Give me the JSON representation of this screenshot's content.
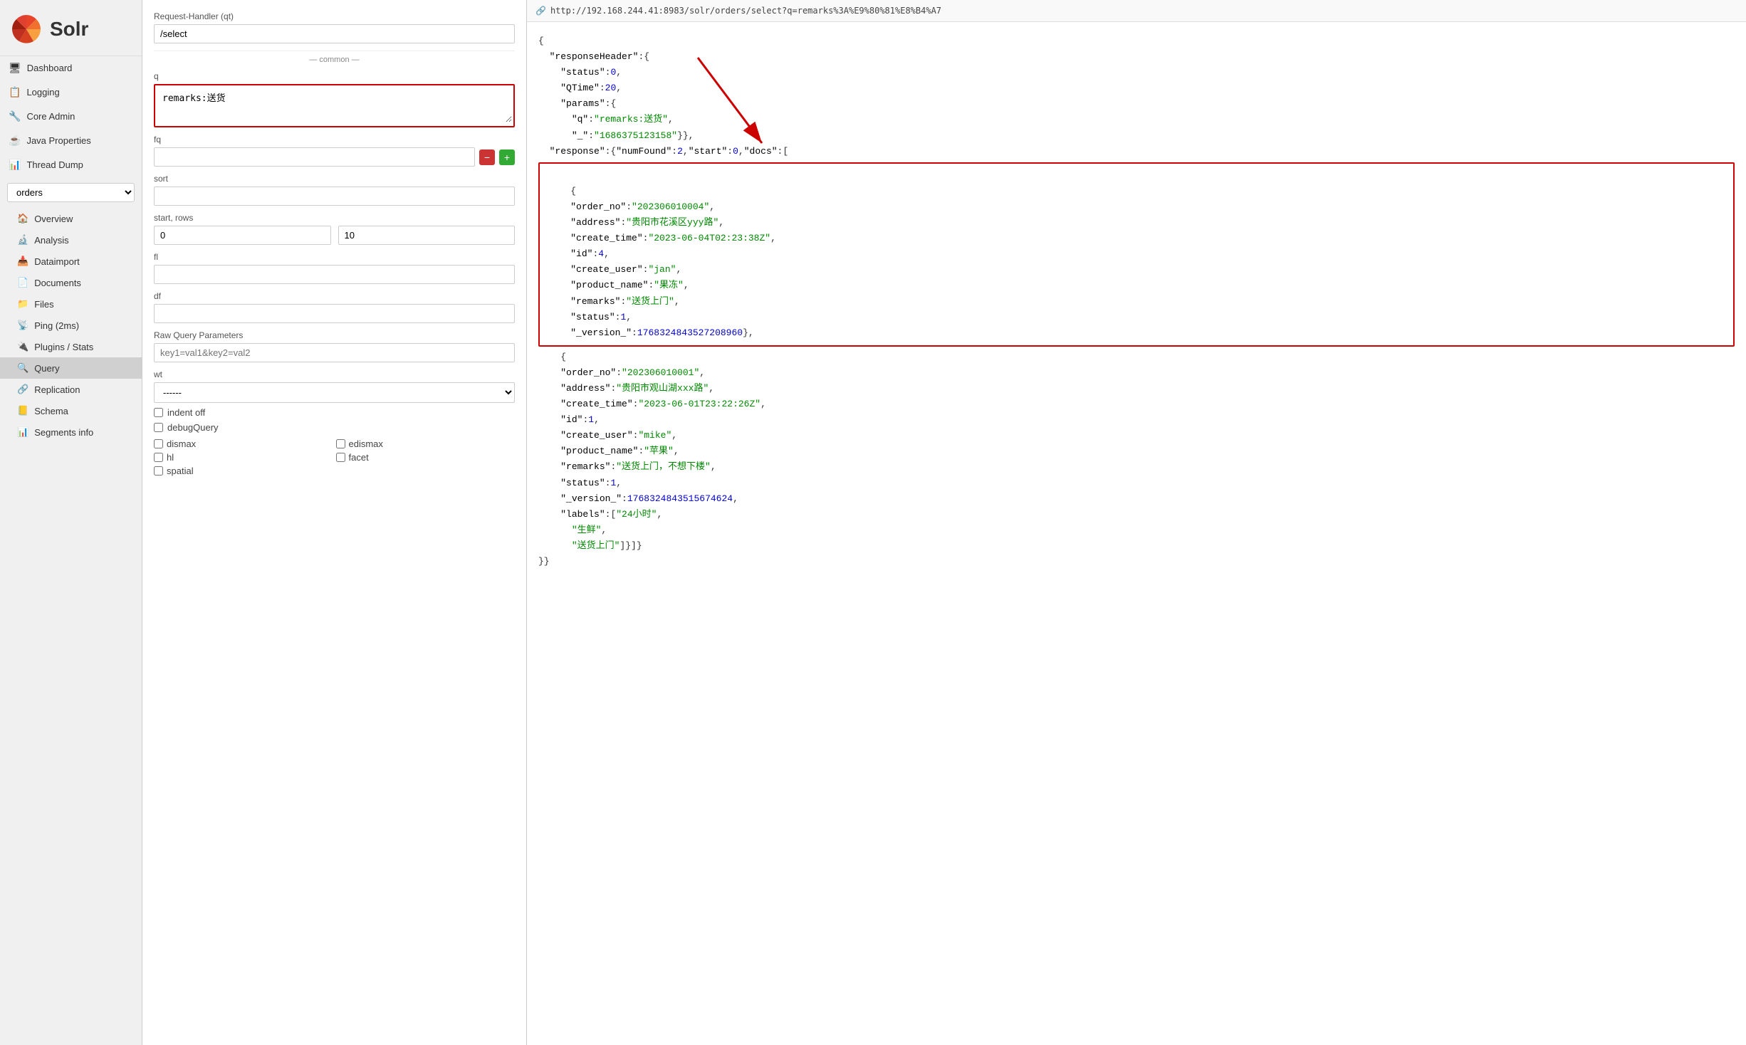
{
  "sidebar": {
    "logo_text": "Solr",
    "nav_items": [
      {
        "id": "dashboard",
        "label": "Dashboard",
        "icon": "🖥"
      },
      {
        "id": "logging",
        "label": "Logging",
        "icon": "📋"
      },
      {
        "id": "core-admin",
        "label": "Core Admin",
        "icon": "🔧"
      },
      {
        "id": "java-properties",
        "label": "Java Properties",
        "icon": "☕"
      },
      {
        "id": "thread-dump",
        "label": "Thread Dump",
        "icon": "📊"
      }
    ],
    "core_selector": {
      "value": "orders",
      "options": [
        "orders"
      ]
    },
    "sub_nav_items": [
      {
        "id": "overview",
        "label": "Overview",
        "icon": "🏠"
      },
      {
        "id": "analysis",
        "label": "Analysis",
        "icon": "🔬"
      },
      {
        "id": "dataimport",
        "label": "Dataimport",
        "icon": "📥"
      },
      {
        "id": "documents",
        "label": "Documents",
        "icon": "📄"
      },
      {
        "id": "files",
        "label": "Files",
        "icon": "📁"
      },
      {
        "id": "ping",
        "label": "Ping (2ms)",
        "icon": "📡"
      },
      {
        "id": "plugins-stats",
        "label": "Plugins / Stats",
        "icon": "🔌"
      },
      {
        "id": "query",
        "label": "Query",
        "icon": "🔍",
        "active": true
      },
      {
        "id": "replication",
        "label": "Replication",
        "icon": "🔗"
      },
      {
        "id": "schema",
        "label": "Schema",
        "icon": "📒"
      },
      {
        "id": "segments-info",
        "label": "Segments info",
        "icon": "📊"
      }
    ]
  },
  "query_panel": {
    "handler_label": "Request-Handler (qt)",
    "handler_value": "/select",
    "common_label": "— common —",
    "q_label": "q",
    "q_value": "remarks:送货",
    "fq_label": "fq",
    "fq_value": "",
    "sort_label": "sort",
    "sort_value": "",
    "start_rows_label": "start, rows",
    "start_value": "0",
    "rows_value": "10",
    "fl_label": "fl",
    "fl_value": "",
    "df_label": "df",
    "df_value": "",
    "raw_label": "Raw Query Parameters",
    "raw_placeholder": "key1=val1&key2=val2",
    "wt_label": "wt",
    "wt_value": "------",
    "indent_label": "indent off",
    "debug_label": "debugQuery",
    "checkboxes": [
      {
        "id": "dismax",
        "label": "dismax"
      },
      {
        "id": "edismax",
        "label": "edismax"
      },
      {
        "id": "hl",
        "label": "hl"
      },
      {
        "id": "facet",
        "label": "facet"
      },
      {
        "id": "spatial",
        "label": "spatial"
      }
    ]
  },
  "response": {
    "url": "http://192.168.244.41:8983/solr/orders/select?q=remarks%3A%E9%80%81%E8%B4%A7",
    "json_lines": [
      "{",
      "  \"responseHeader\":{",
      "    \"status\":0,",
      "    \"QTime\":20,",
      "    \"params\":{",
      "      \"q\":\"remarks:送货\",",
      "      \"_\":\"1686375123158\"}},",
      "  \"response\":{\"numFound\":2,\"start\":0,\"docs\":["
    ],
    "doc1": {
      "order_no": "202306010004",
      "address": "贵阳市花溪区yyy路",
      "create_time": "2023-06-04T02:23:38Z",
      "id": "4",
      "create_user": "jan",
      "product_name": "果冻",
      "remarks": "送货上门",
      "status": "1",
      "version": "1768324843527208960"
    },
    "doc2": {
      "order_no": "202306010001",
      "address": "贵阳市观山湖xxx路",
      "create_time": "2023-06-01T23:22:26Z",
      "id": "1",
      "create_user": "mike",
      "product_name": "苹果",
      "remarks": "送货上门，不想下楼",
      "status": "1",
      "version": "1768324843515674624",
      "labels": [
        "24小时",
        "生鲜",
        "送货上门"
      ]
    },
    "closing": "}}"
  }
}
